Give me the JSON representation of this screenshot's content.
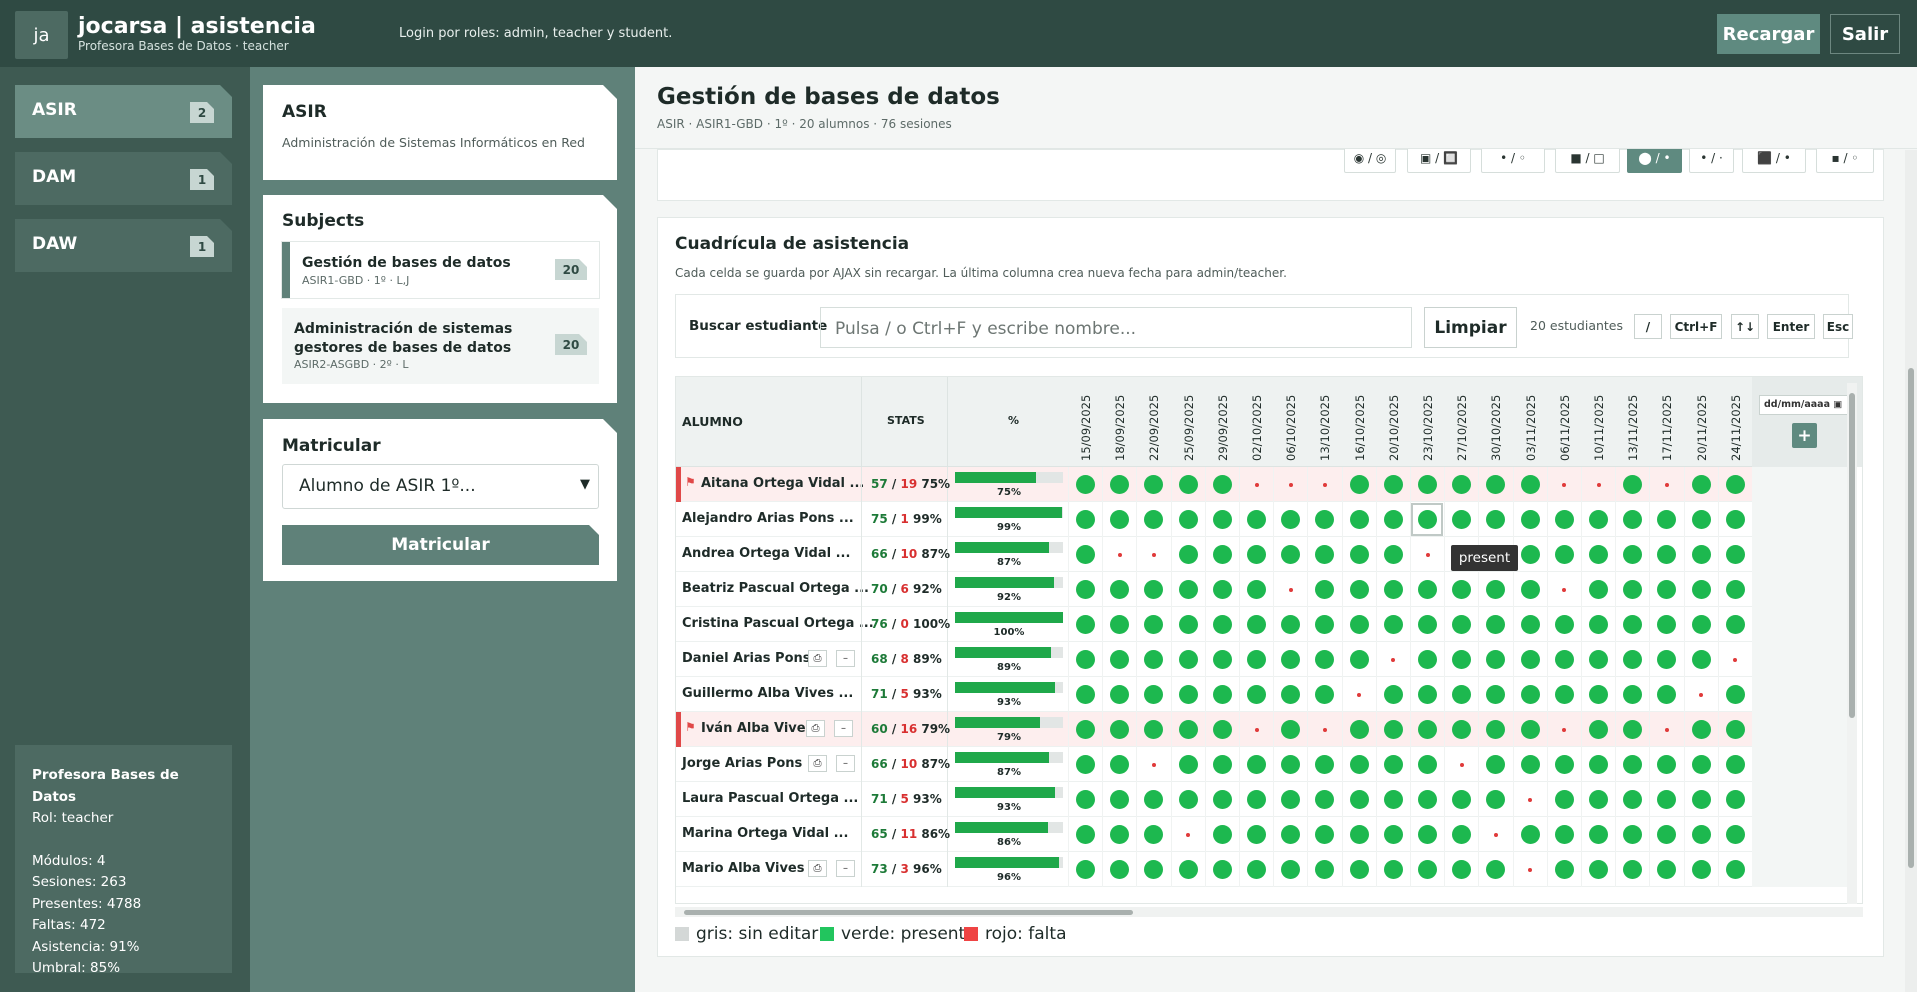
{
  "header": {
    "logo": "ja",
    "title": "jocarsa | asistencia",
    "subtitle": "Profesora Bases de Datos · teacher",
    "login_note": "Login por roles: admin, teacher y student.",
    "reload_label": "Recargar",
    "exit_label": "Salir"
  },
  "modules": [
    {
      "label": "ASIR",
      "count": "2"
    },
    {
      "label": "DAM",
      "count": "1"
    },
    {
      "label": "DAW",
      "count": "1"
    }
  ],
  "user_stats": {
    "name": "Profesora Bases de Datos",
    "role": "Rol: teacher",
    "modules": "Módulos: 4",
    "sessions": "Sesiones: 263",
    "present": "Presentes: 4788",
    "absences": "Faltas: 472",
    "attendance": "Asistencia: 91%",
    "threshold": "Umbral: 85%"
  },
  "module_card": {
    "title": "ASIR",
    "description": "Administración de Sistemas Informáticos en Red"
  },
  "subjects": {
    "title": "Subjects",
    "items": [
      {
        "name": "Gestión de bases de datos",
        "code": "ASIR1-GBD · 1º · L,J",
        "count": "20"
      },
      {
        "name": "Administración de sistemas gestores de bases de datos",
        "code": "ASIR2-ASGBD · 2º · L",
        "count": "20"
      }
    ]
  },
  "enroll": {
    "title": "Matricular",
    "select_value": "Alumno de ASIR 1º...",
    "button_label": "Matricular"
  },
  "main": {
    "title": "Gestión de bases de datos",
    "subtitle": "ASIR · ASIR1-GBD · 1º · 20 alumnos · 76 sesiones"
  },
  "toolbar_buttons": [
    "◉ / ◎",
    "▣ / 🔲",
    "• / ◦",
    "■ / □",
    "⬤ / •",
    "• / ·",
    "⬛ / •",
    "▪ / ◦"
  ],
  "grid": {
    "title": "Cuadrícula de asistencia",
    "description": "Cada celda se guarda por AJAX sin recargar. La última columna crea nueva fecha para admin/teacher.",
    "search_label": "Buscar estudiante",
    "search_placeholder": "Pulsa / o Ctrl+F y escribe nombre...",
    "clear_label": "Limpiar",
    "count_text": "20 estudiantes",
    "keys": [
      "/",
      "Ctrl+F",
      "↑↓",
      "Enter",
      "Esc"
    ],
    "col_student": "ALUMNO",
    "col_stats": "STATS",
    "col_pct": "%",
    "new_date_placeholder": "dd/mm/aaaa",
    "add_label": "+",
    "dates": [
      "15/09/2025",
      "18/09/2025",
      "22/09/2025",
      "25/09/2025",
      "29/09/2025",
      "02/10/2025",
      "06/10/2025",
      "13/10/2025",
      "16/10/2025",
      "20/10/2025",
      "23/10/2025",
      "27/10/2025",
      "30/10/2025",
      "03/11/2025",
      "06/11/2025",
      "10/11/2025",
      "13/11/2025",
      "17/11/2025",
      "20/11/2025",
      "24/11/2025"
    ],
    "rows": [
      {
        "name": "Aitana Ortega Vidal ...",
        "present": "57",
        "absent": "19",
        "pct_label": "75%",
        "pct": 75,
        "flag": true,
        "cells": "PPPPPAAAPPPPPPAAPAPP"
      },
      {
        "name": "Alejandro Arias Pons ...",
        "present": "75",
        "absent": "1",
        "pct_label": "99%",
        "pct": 99,
        "flag": false,
        "cells": "PPPPPPPPPPPPPPPPPPPP"
      },
      {
        "name": "Andrea Ortega Vidal ...",
        "present": "66",
        "absent": "10",
        "pct_label": "87%",
        "pct": 87,
        "flag": false,
        "cells": "PAAPPPPPPPAPPPPPPPPP"
      },
      {
        "name": "Beatriz Pascual Ortega ...",
        "present": "70",
        "absent": "6",
        "pct_label": "92%",
        "pct": 92,
        "flag": false,
        "cells": "PPPPPPAPPPPPPPAPPPPP"
      },
      {
        "name": "Cristina Pascual Ortega ...",
        "present": "76",
        "absent": "0",
        "pct_label": "100%",
        "pct": 100,
        "flag": false,
        "cells": "PPPPPPPPPPPPPPPPPPPP"
      },
      {
        "name": "Daniel Arias Pons",
        "present": "68",
        "absent": "8",
        "pct_label": "89%",
        "pct": 89,
        "flag": false,
        "cells": "PPPPPPPPPAPPPPPPPPPA"
      },
      {
        "name": "Guillermo Alba Vives ...",
        "present": "71",
        "absent": "5",
        "pct_label": "93%",
        "pct": 93,
        "flag": false,
        "cells": "PPPPPPPPAPPPPPPPPPAP"
      },
      {
        "name": "Iván Alba Vives",
        "present": "60",
        "absent": "16",
        "pct_label": "79%",
        "pct": 79,
        "flag": true,
        "cells": "PPPPPAPAPPPPPPAPPAPP"
      },
      {
        "name": "Jorge Arias Pons",
        "present": "66",
        "absent": "10",
        "pct_label": "87%",
        "pct": 87,
        "flag": false,
        "cells": "PPAPPPPPPPPAPPPPPPPP"
      },
      {
        "name": "Laura Pascual Ortega ...",
        "present": "71",
        "absent": "5",
        "pct_label": "93%",
        "pct": 93,
        "flag": false,
        "cells": "PPPPPPPPPPPPPAPPPPPP"
      },
      {
        "name": "Marina Ortega Vidal ...",
        "present": "65",
        "absent": "11",
        "pct_label": "86%",
        "pct": 86,
        "flag": false,
        "cells": "PPPAPPPPPPPPAPPPPPPP"
      },
      {
        "name": "Mario Alba Vives",
        "present": "73",
        "absent": "3",
        "pct_label": "96%",
        "pct": 96,
        "flag": false,
        "cells": "PPPPPPPPPPPPPAPPPPPP"
      }
    ],
    "tooltip": "present",
    "legend": [
      {
        "label": "gris: sin editar",
        "color": "#d4d8d7"
      },
      {
        "label": "verde: presente",
        "color": "#22c55e"
      },
      {
        "label": "rojo: falta",
        "color": "#ef4444"
      }
    ]
  }
}
